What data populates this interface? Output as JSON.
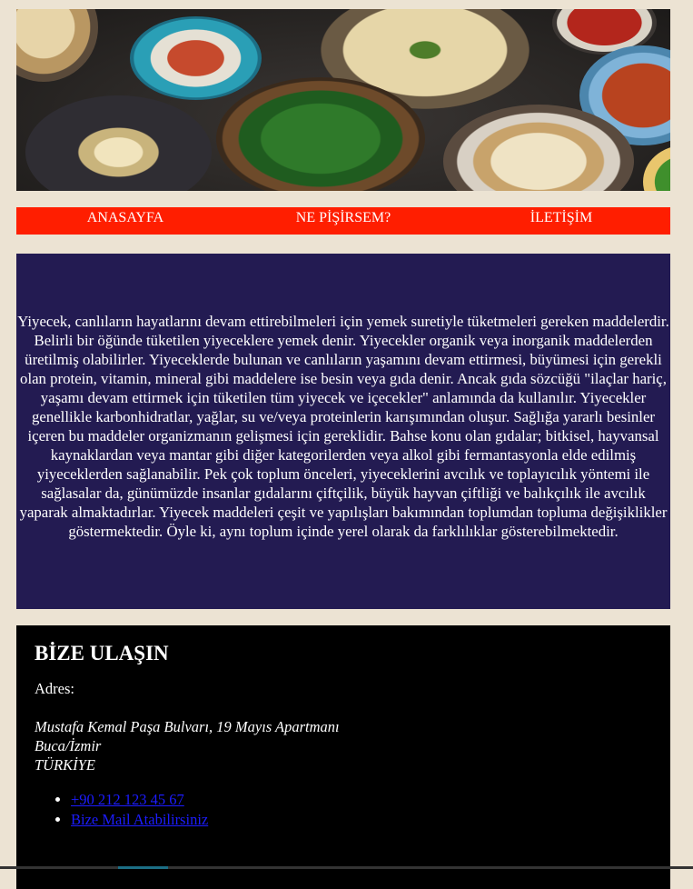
{
  "nav": {
    "items": [
      {
        "label": "ANASAYFA"
      },
      {
        "label": "NE PİŞİRSEM?"
      },
      {
        "label": "İLETİŞİM"
      }
    ]
  },
  "info": {
    "text": "Yiyecek, canlıların hayatlarını devam ettirebilmeleri için yemek suretiyle tüketmeleri gereken maddelerdir. Belirli bir öğünde tüketilen yiyeceklere yemek denir. Yiyecekler organik veya inorganik maddelerden üretilmiş olabilirler. Yiyeceklerde bulunan ve canlıların yaşamını devam ettirmesi, büyümesi için gerekli olan protein, vitamin, mineral gibi maddelere ise besin veya gıda denir. Ancak gıda sözcüğü \"ilaçlar hariç, yaşamı devam ettirmek için tüketilen tüm yiyecek ve içecekler\" anlamında da kullanılır. Yiyecekler genellikle karbonhidratlar, yağlar, su ve/veya proteinlerin karışımından oluşur. Sağlığa yararlı besinler içeren bu maddeler organizmanın gelişmesi için gereklidir. Bahse konu olan gıdalar; bitkisel, hayvansal kaynaklardan veya mantar gibi diğer kategorilerden veya alkol gibi fermantasyonla elde edilmiş yiyeceklerden sağlanabilir. Pek çok toplum önceleri, yiyeceklerini avcılık ve toplayıcılık yöntemi ile sağlasalar da, günümüzde insanlar gıdalarını çiftçilik, büyük hayvan çiftliği ve balıkçılık ile avcılık yaparak almaktadırlar. Yiyecek maddeleri çeşit ve yapılışları bakımından toplumdan topluma değişiklikler göstermektedir. Öyle ki, aynı toplum içinde yerel olarak da farklılıklar gösterebilmektedir."
  },
  "contact": {
    "title": "BİZE ULAŞIN",
    "address_label": "Adres:",
    "address_lines": [
      "Mustafa Kemal Paşa Bulvarı, 19 Mayıs Apartmanı",
      "Buca/İzmir",
      "TÜRKİYE"
    ],
    "links": [
      {
        "label": "+90 212 123 45 67"
      },
      {
        "label": "Bize Mail Atabilirsiniz"
      }
    ]
  },
  "colors": {
    "page_bg": "#ece3d3",
    "nav_bg": "#ff1e00",
    "info_bg": "#231b52",
    "contact_bg": "#000000",
    "link": "#1c1cff"
  }
}
